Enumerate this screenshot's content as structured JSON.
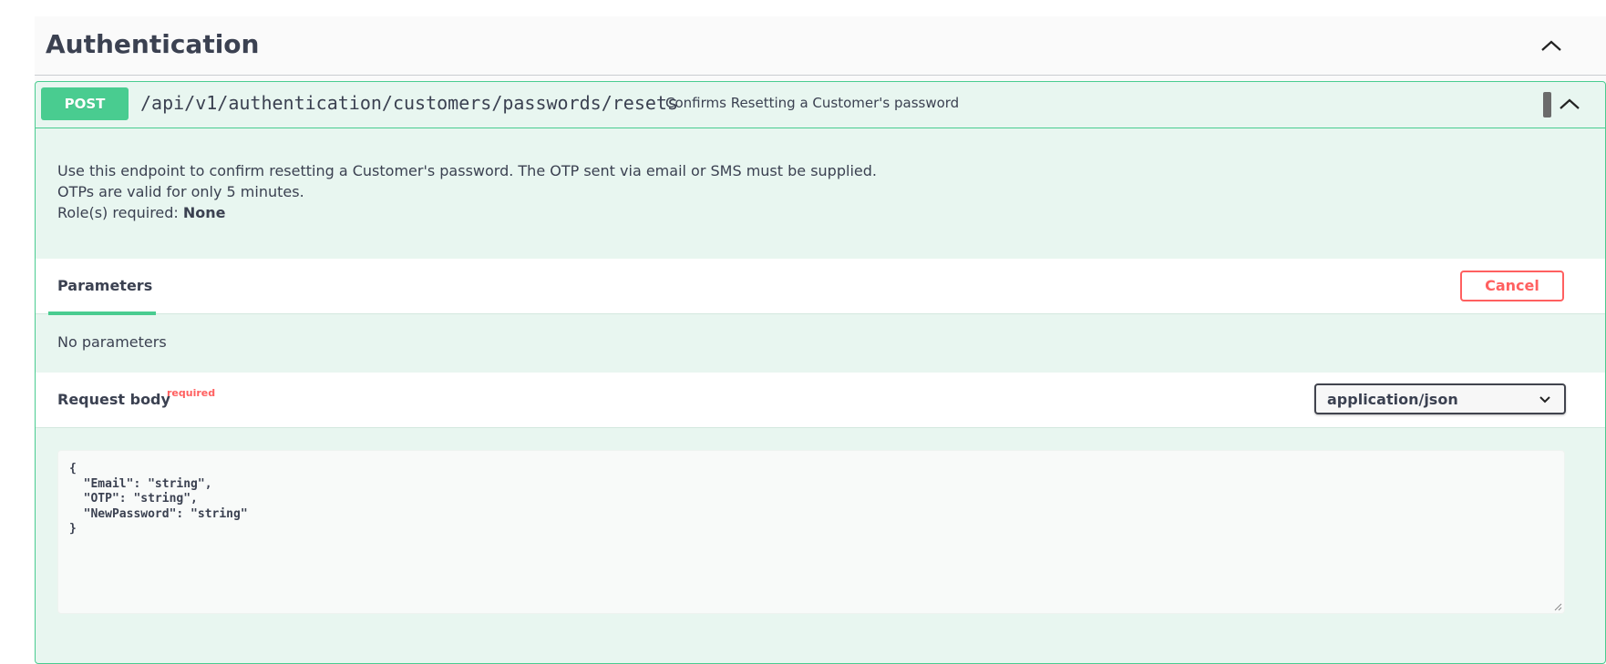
{
  "section": {
    "title": "Authentication"
  },
  "endpoint": {
    "method": "POST",
    "path": "/api/v1/authentication/customers/passwords/resets",
    "summary": "Confirms Resetting a Customer's password",
    "description_lines": [
      "Use this endpoint to confirm resetting a Customer's password. The OTP sent via email or SMS must be supplied.",
      "OTPs are valid for only 5 minutes."
    ],
    "roles_label": "Role(s) required: ",
    "roles_value": "None",
    "method_color": "#49cc90"
  },
  "parameters": {
    "tab_label": "Parameters",
    "cancel_label": "Cancel",
    "empty_text": "No parameters"
  },
  "request_body": {
    "title": "Request body",
    "required_label": "required",
    "content_type": "application/json",
    "example": "{\n  \"Email\": \"string\",\n  \"OTP\": \"string\",\n  \"NewPassword\": \"string\"\n}"
  },
  "icons": {
    "section_toggle": "chevron-up-icon",
    "collapse": "chevron-up-icon",
    "lock": "lock-icon",
    "select": "chevron-down-icon",
    "resize": "resize-handle-icon"
  }
}
